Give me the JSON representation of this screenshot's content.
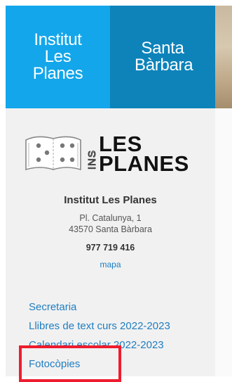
{
  "header": {
    "tab_institut": "Institut Les Planes",
    "tab_santa": "Santa Bàrbara"
  },
  "logo": {
    "line1": "LES",
    "line2": "PLANES",
    "vertical": "INS"
  },
  "info": {
    "name": "Institut Les Planes",
    "address_line1": "Pl. Catalunya, 1",
    "address_line2": "43570 Santa Bàrbara",
    "phone": "977 719 416",
    "map_link": "mapa"
  },
  "menu": {
    "items": [
      {
        "label": "Secretaria"
      },
      {
        "label": "Llibres de text curs 2022-2023"
      },
      {
        "label": "Calendari escolar 2022-2023"
      },
      {
        "label": "Fotocòpies"
      }
    ]
  },
  "colors": {
    "tab_left": "#13a6ea",
    "tab_right": "#0d83ba",
    "link": "#1f7ec1",
    "highlight": "#ee1c2e"
  }
}
